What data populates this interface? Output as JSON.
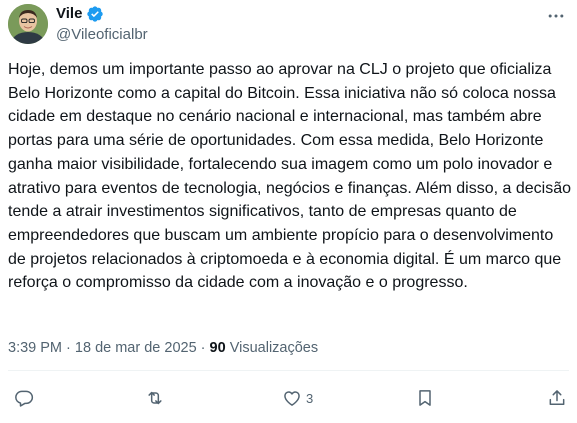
{
  "author": {
    "name": "Vile",
    "handle": "@Vileoficialbr",
    "verified": true,
    "avatar_icon": "avatar"
  },
  "tweet": {
    "text": "Hoje, demos um importante passo ao aprovar na CLJ o projeto que oficializa Belo Horizonte como a capital do Bitcoin. Essa iniciativa não só coloca nossa cidade em destaque no cenário nacional e internacional, mas também abre portas para uma série de oportunidades. Com essa medida, Belo Horizonte ganha maior visibilidade, fortalecendo sua imagem como um polo inovador e atrativo para eventos de tecnologia, negócios e finanças. Além disso, a decisão tende a atrair investimentos significativos, tanto de empresas quanto de empreendedores que buscam um ambiente propício para o desenvolvimento de projetos relacionados à criptomoeda e à economia digital. É um marco que reforça o compromisso da cidade com a inovação e o progresso.",
    "time": "3:39 PM",
    "date": "18 de mar de 2025",
    "separator": "·",
    "views_count": "90",
    "views_label": "Visualizações"
  },
  "actions": {
    "reply_icon": "reply-icon",
    "retweet_icon": "retweet-icon",
    "like_icon": "like-icon",
    "like_count": "3",
    "bookmark_icon": "bookmark-icon",
    "share_icon": "share-icon"
  },
  "colors": {
    "text": "#0f1419",
    "secondary": "#536471",
    "verified": "#1d9bf0",
    "divider": "#eff3f4"
  }
}
